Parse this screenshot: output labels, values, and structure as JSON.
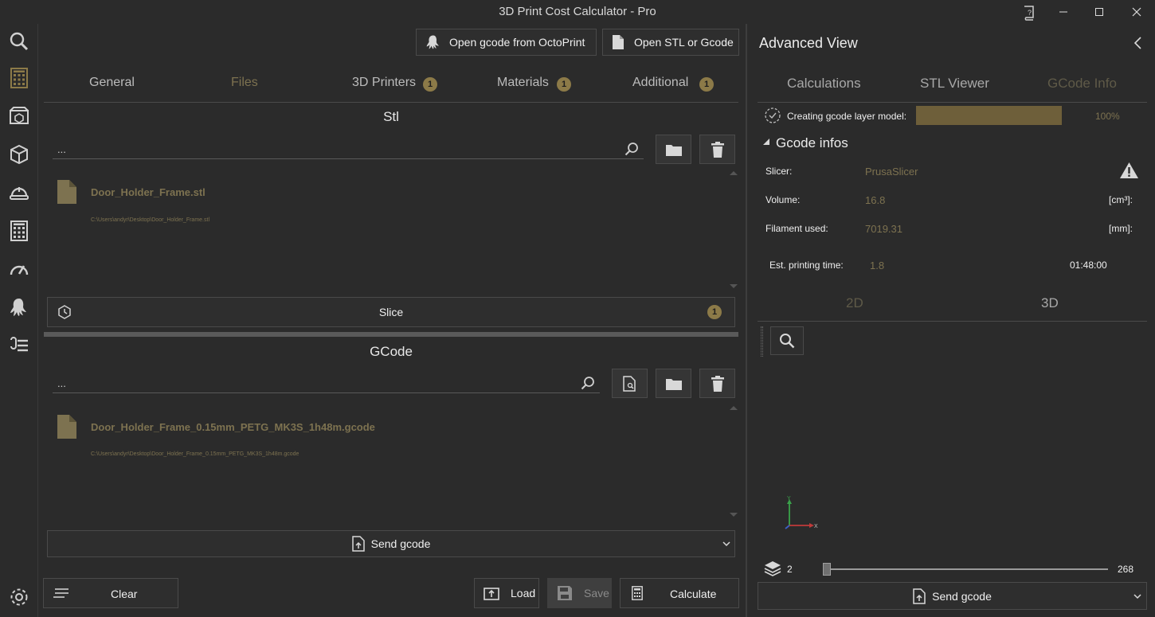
{
  "app": {
    "title": "3D Print Cost Calculator - Pro"
  },
  "toolbar": {
    "octoprint_label": "Open gcode from OctoPrint",
    "open_file_label": "Open STL or Gcode"
  },
  "tabs": [
    {
      "label": "General"
    },
    {
      "label": "Files",
      "active": true
    },
    {
      "label": "3D Printers",
      "badge": "1"
    },
    {
      "label": "Materials",
      "badge": "1"
    },
    {
      "label": "Additional",
      "badge": "1"
    }
  ],
  "stl": {
    "title": "Stl",
    "input_value": "...",
    "file_name": "Door_Holder_Frame.stl",
    "file_path": "C:\\Users\\andyr\\Desktop\\Door_Holder_Frame.stl",
    "slice_label": "Slice",
    "slice_badge": "1"
  },
  "gcode": {
    "title": "GCode",
    "input_value": "...",
    "file_name": "Door_Holder_Frame_0.15mm_PETG_MK3S_1h48m.gcode",
    "file_path": "C:\\Users\\andyr\\Desktop\\Door_Holder_Frame_0.15mm_PETG_MK3S_1h48m.gcode",
    "send_label": "Send gcode"
  },
  "bottom_bar": {
    "clear_label": "Clear",
    "load_label": "Load",
    "save_label": "Save",
    "calculate_label": "Calculate"
  },
  "advanced": {
    "title": "Advanced View",
    "tabs": [
      {
        "label": "Calculations"
      },
      {
        "label": "STL Viewer"
      },
      {
        "label": "GCode Info",
        "active": true
      }
    ],
    "progress_label": "Creating gcode layer model:",
    "progress_value": 1.0,
    "progress_text": "100%",
    "gcode_infos_title": "Gcode infos",
    "slicer_label": "Slicer:",
    "slicer_value": "PrusaSlicer",
    "volume_label": "Volume:",
    "volume_value": "16.8",
    "volume_unit": "[cm³]:",
    "filament_label": "Filament used:",
    "filament_value": "7019.31",
    "filament_unit": "[mm]:",
    "time_label": "Est. printing time:",
    "time_value": "1.8",
    "time_formatted": "01:48:00",
    "view_tabs": [
      {
        "label": "2D"
      },
      {
        "label": "3D"
      }
    ],
    "layer_min": "2",
    "layer_max": "268",
    "send_label": "Send gcode"
  },
  "colors": {
    "background": "#2b2b2b",
    "accent": "#8c7a48",
    "file_text": "#7d7250",
    "progress_fill": "#6e5f3a"
  }
}
